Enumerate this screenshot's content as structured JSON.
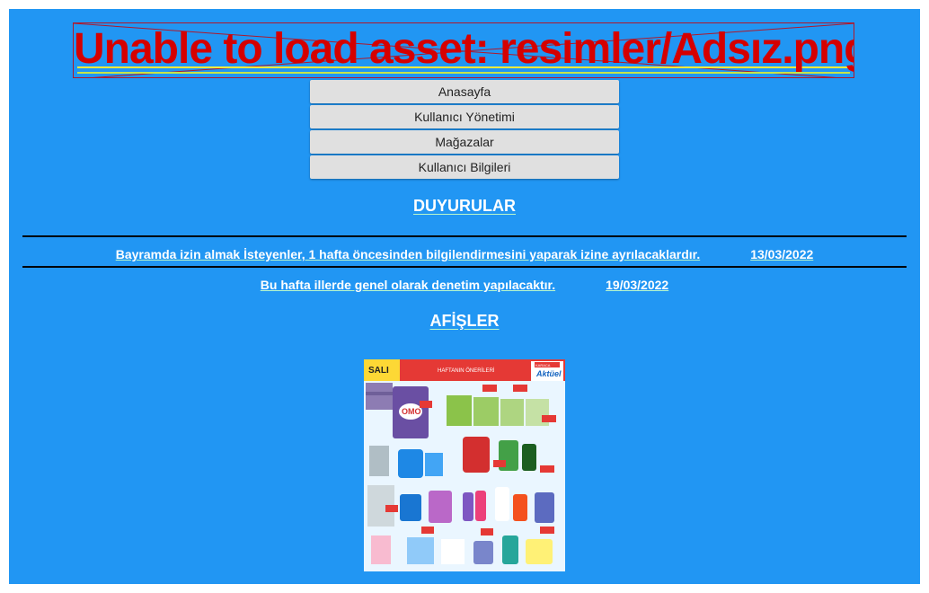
{
  "error": {
    "message": "Unable to load asset: resimler/Adsız.png"
  },
  "menu": {
    "items": [
      "Anasayfa",
      "Kullanıcı Yönetimi",
      "Mağazalar",
      "Kullanıcı Bilgileri"
    ]
  },
  "announcements": {
    "title": "DUYURULAR",
    "items": [
      {
        "text": "Bayramda izin almak İsteyenler, 1 hafta öncesinden bilgilendirmesini yaparak izine ayrılacaklardır.",
        "date": "13/03/2022"
      },
      {
        "text": "Bu hafta illerde genel olarak denetim yapılacaktır.",
        "date": "19/03/2022"
      }
    ]
  },
  "posters": {
    "title": "AFİŞLER",
    "poster": {
      "day": "SALI",
      "header": "HAFTANIN ÖNERİLERİ",
      "brand_small": "KARACA",
      "brand": "Aktüel",
      "product": "OMO",
      "colors": {
        "header_red": "#e53935",
        "brand_blue": "#1565c0",
        "bg": "#e8f5ff"
      }
    }
  },
  "colors": {
    "background": "#2196f3",
    "error": "#d50000",
    "button": "#e0e0e0"
  }
}
